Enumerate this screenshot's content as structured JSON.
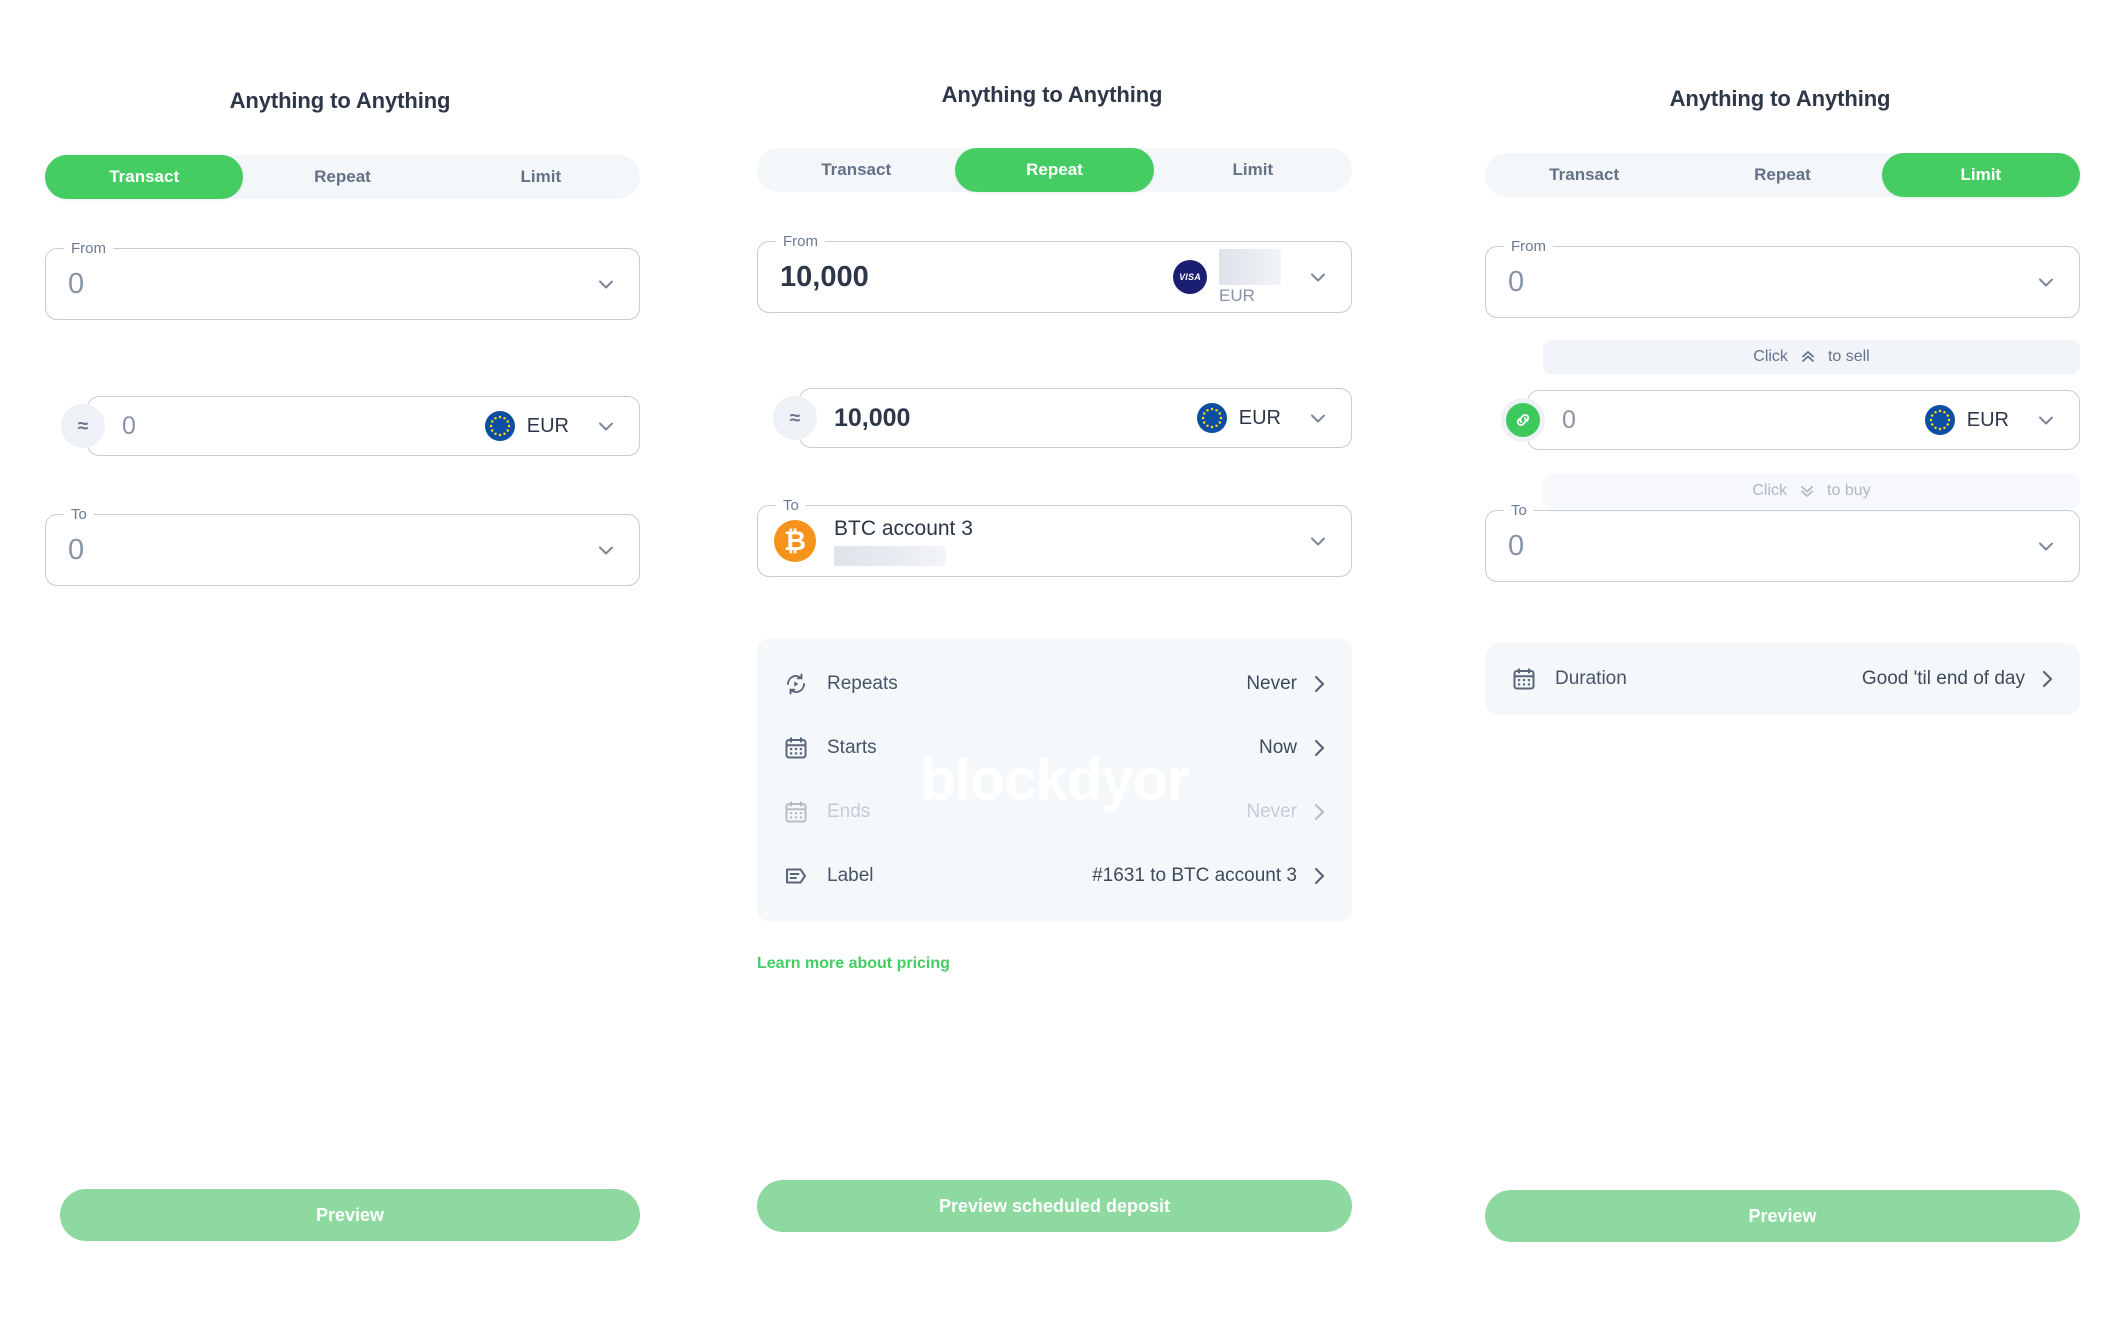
{
  "panels": [
    {
      "id": "transact",
      "title": "Anything to Anything",
      "tabs": [
        {
          "label": "Transact",
          "active": true
        },
        {
          "label": "Repeat",
          "active": false
        },
        {
          "label": "Limit",
          "active": false
        }
      ],
      "from": {
        "legend": "From",
        "value": "0"
      },
      "middle": {
        "badge_icon": "approx-equals-icon",
        "value": "0",
        "currency": "EUR",
        "flag": "eu-flag-icon"
      },
      "to": {
        "legend": "To",
        "value": "0"
      },
      "cta": {
        "label": "Preview"
      }
    },
    {
      "id": "repeat",
      "title": "Anything to Anything",
      "tabs": [
        {
          "label": "Transact",
          "active": false
        },
        {
          "label": "Repeat",
          "active": true
        },
        {
          "label": "Limit",
          "active": false
        }
      ],
      "from": {
        "legend": "From",
        "value": "10,000",
        "card_brand": "VISA",
        "currency_sub": "EUR"
      },
      "middle": {
        "badge_icon": "approx-equals-icon",
        "value": "10,000",
        "currency": "EUR",
        "flag": "eu-flag-icon"
      },
      "to": {
        "legend": "To",
        "account_name": "BTC account 3",
        "coin": "BTC"
      },
      "settings": [
        {
          "label": "Repeats",
          "value": "Never",
          "icon": "repeat-icon",
          "disabled": false
        },
        {
          "label": "Starts",
          "value": "Now",
          "icon": "calendar-icon",
          "disabled": false
        },
        {
          "label": "Ends",
          "value": "Never",
          "icon": "calendar-icon",
          "disabled": true
        },
        {
          "label": "Label",
          "value": "#1631 to BTC account 3",
          "icon": "tag-icon",
          "disabled": false
        }
      ],
      "watermark": "blockdyor",
      "pricing_link": "Learn more about pricing",
      "cta": {
        "label": "Preview scheduled deposit"
      }
    },
    {
      "id": "limit",
      "title": "Anything to Anything",
      "tabs": [
        {
          "label": "Transact",
          "active": false
        },
        {
          "label": "Repeat",
          "active": false
        },
        {
          "label": "Limit",
          "active": true
        }
      ],
      "from": {
        "legend": "From",
        "value": "0"
      },
      "hint_sell": {
        "prefix": "Click",
        "suffix": "to sell",
        "icon": "double-chevron-up-icon"
      },
      "middle": {
        "badge_icon": "link-chain-icon",
        "value": "0",
        "currency": "EUR",
        "flag": "eu-flag-icon"
      },
      "hint_buy": {
        "prefix": "Click",
        "suffix": "to buy",
        "icon": "double-chevron-down-icon"
      },
      "to": {
        "legend": "To",
        "value": "0"
      },
      "settings": [
        {
          "label": "Duration",
          "value": "Good 'til end of day",
          "icon": "calendar-icon",
          "disabled": false
        }
      ],
      "cta": {
        "label": "Preview"
      }
    }
  ],
  "colors": {
    "accent_green": "#45cc63",
    "cta_green": "#8dd99f",
    "bitcoin_orange": "#f7931a",
    "visa_navy": "#1a1f71",
    "eu_blue": "#0b4ea2",
    "border": "#c2cdda",
    "text_dark": "#2d3748",
    "text_muted": "#8894a6",
    "panel_bg": "#f5f8fb"
  }
}
